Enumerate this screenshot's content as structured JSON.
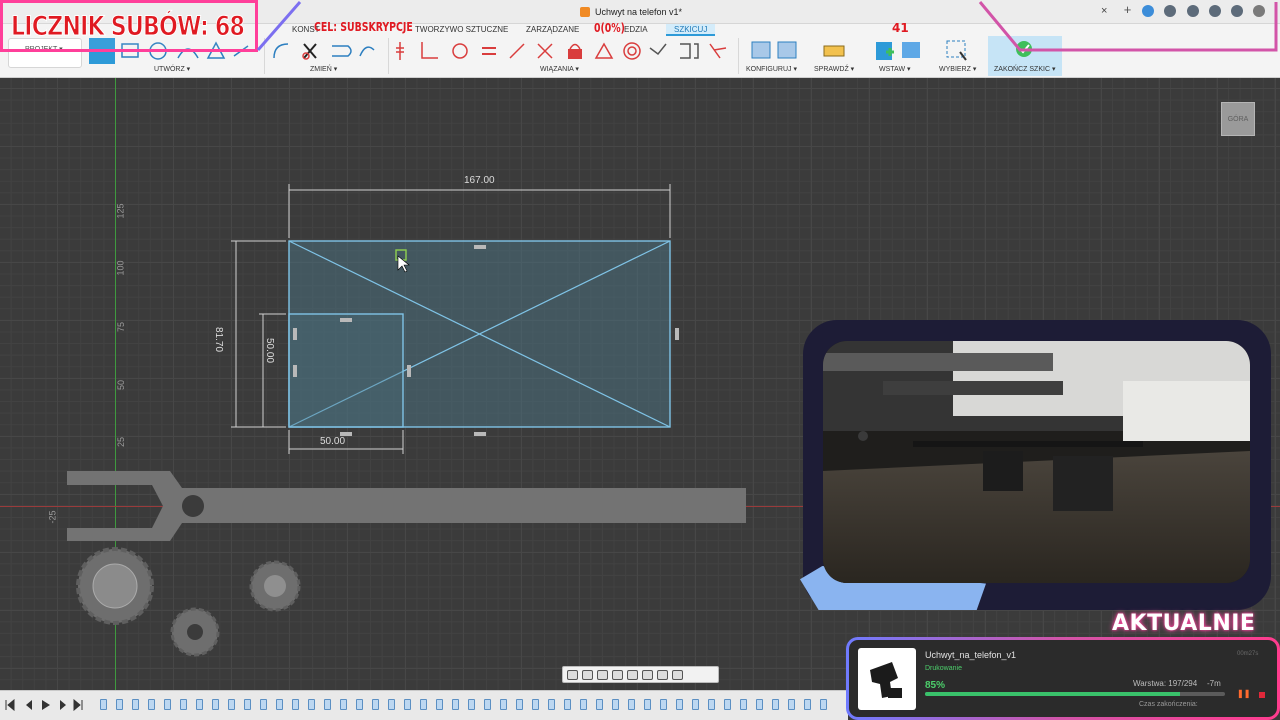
{
  "document": {
    "title": "Uchwyt na telefon v1*",
    "close_glyph": "×",
    "new_tab_glyph": "+"
  },
  "ribbon": {
    "tabs": [
      "KONST",
      "TWORZYWO SZTUCZNE",
      "ZARZĄDZANE",
      "EDZIA",
      "SZKICUJ"
    ],
    "active_tab": "SZKICUJ",
    "project_label": "PROJEKT ▾",
    "groups": {
      "create": "UTWÓRZ ▾",
      "modify": "ZMIEŃ ▾",
      "constraints": "WIĄZANIA ▾",
      "configure": "KONFIGURUJ ▾",
      "inspect": "SPRAWDŹ ▾",
      "insert": "WSTAW ▾",
      "select": "WYBIERZ ▾",
      "finish_sketch": "ZAKOŃCZ SZKIC ▾"
    }
  },
  "viewcube": {
    "label": "GÓRA"
  },
  "axis": {
    "ticks": [
      "125",
      "100",
      "75",
      "50",
      "25",
      "-25"
    ]
  },
  "sketch": {
    "dimensions": {
      "width_total": "167.00",
      "height_total": "81.70",
      "inner_height": "50.00",
      "inner_width": "50.00"
    }
  },
  "overlay": {
    "subs_counter": "LICZNIK SUBÓW: 68",
    "goal_label": "CEL: SUBSKRYPCJE",
    "goal_progress": "0(0%)",
    "goal_value": "41"
  },
  "printer": {
    "section_title": "AKTUALNIE",
    "file_name": "Uchwyt_na_telefon_v1",
    "status": "Drukowanie",
    "elapsed": "00m27s",
    "progress_percent": 85,
    "progress_label": "85%",
    "layer": "Warstwa: 197/294",
    "remaining": "-7m",
    "end_time_label": "Czas zakończenia:",
    "pause_glyph": "❚❚"
  },
  "colors": {
    "sketch_line": "#7fc3e6",
    "sketch_fill": "#4b6f7e",
    "overlay_red": "#e01a22",
    "overlay_pink": "#ff3f9a",
    "progress_green": "#39c16a"
  }
}
